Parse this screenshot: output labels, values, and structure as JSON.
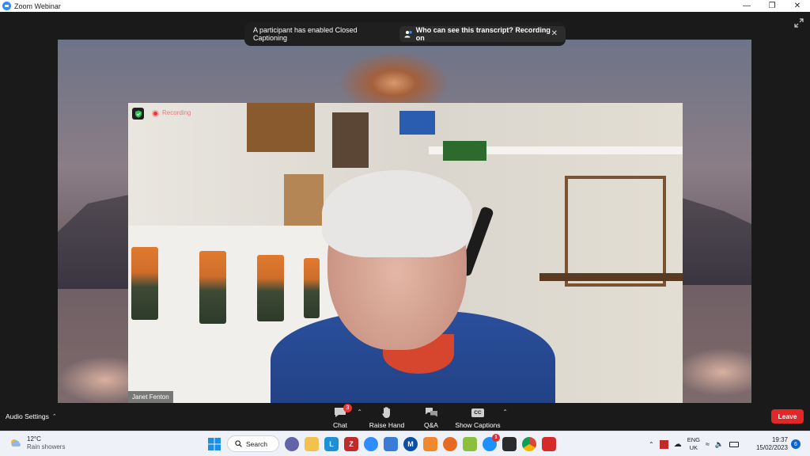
{
  "window": {
    "title": "Zoom Webinar",
    "controls": [
      "minimize",
      "restore",
      "close"
    ]
  },
  "banner": {
    "message": "A participant has enabled Closed Captioning",
    "transcript_link": "Who can see this transcript? Recording on",
    "close_label": "✕"
  },
  "video": {
    "recording_label": "Recording",
    "participant_name": "Janet Fenton"
  },
  "toolbar": {
    "audio_settings": "Audio Settings",
    "chat_label": "Chat",
    "chat_badge": "3",
    "raise_hand_label": "Raise Hand",
    "qa_label": "Q&A",
    "captions_label": "Show Captions",
    "captions_icon_text": "CC",
    "leave_label": "Leave"
  },
  "taskbar": {
    "weather_temp": "12°C",
    "weather_desc": "Rain showers",
    "search_label": "Search",
    "apps": [
      "windows-start",
      "search",
      "teams-chat",
      "file-explorer",
      "lexoffice",
      "filezilla",
      "zoom",
      "snipping-tool",
      "malwarebytes",
      "sublime",
      "firefox",
      "notepadplusplus",
      "messenger",
      "terminal",
      "chrome",
      "puzzle"
    ],
    "messenger_badge": "1",
    "tray": {
      "lang_line1": "ENG",
      "lang_line2": "UK",
      "time": "19:37",
      "date": "15/02/2023",
      "notifications": "6"
    }
  },
  "colors": {
    "zoom_blue": "#2d8cff",
    "leave_red": "#e02828",
    "toolbar_bg": "#1a1a1a",
    "taskbar_bg": "#eef1f7"
  }
}
